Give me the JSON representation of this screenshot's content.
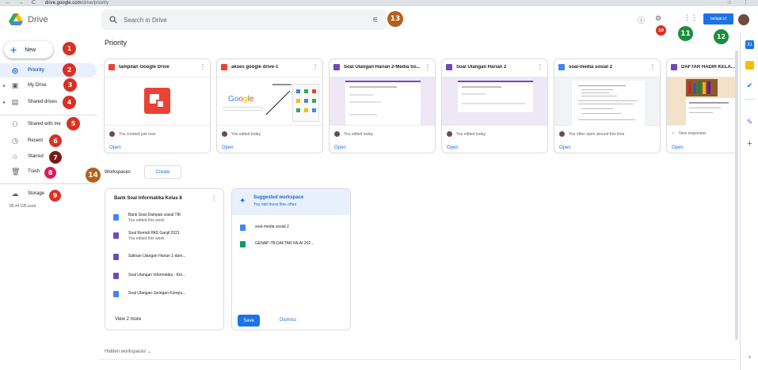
{
  "browser": {
    "nav": "← → C",
    "url_host": "drive.google.com",
    "url_path": "/drive/priority"
  },
  "app": {
    "name": "Drive",
    "search_placeholder": "Search in Drive"
  },
  "header": {
    "account_label": "belajar.id"
  },
  "sidebar": {
    "new_label": "New",
    "items": [
      {
        "label": "Priority",
        "icon": "checkmark-circle-icon"
      },
      {
        "label": "My Drive",
        "icon": "my-drive-icon"
      },
      {
        "label": "Shared drives",
        "icon": "shared-drives-icon"
      },
      {
        "label": "Shared with me",
        "icon": "people-icon"
      },
      {
        "label": "Recent",
        "icon": "clock-icon"
      },
      {
        "label": "Starred",
        "icon": "star-icon"
      },
      {
        "label": "Trash",
        "icon": "trash-icon"
      },
      {
        "label": "Storage",
        "icon": "cloud-icon"
      }
    ],
    "storage_used": "85.44 GB used"
  },
  "badges": [
    "1",
    "2",
    "3",
    "4",
    "5",
    "6",
    "7",
    "8",
    "9",
    "10",
    "11",
    "12",
    "13",
    "14"
  ],
  "colors": {
    "badge_red": "#d93025",
    "badge_dark_red": "#7b1a1a",
    "badge_brown": "#b45f1c",
    "badge_green": "#1e8e3e",
    "badge_magenta": "#d81b60",
    "accent": "#1a73e8"
  },
  "main": {
    "title": "Priority",
    "cards": [
      {
        "title": "tampilan Google Drive",
        "type": "slides",
        "meta": "You created just now",
        "action": "Open"
      },
      {
        "title": "akses google drive-1",
        "type": "slides",
        "meta": "You edited today",
        "action": "Open"
      },
      {
        "title": "Soal Ulangan Harian 2-Media So...",
        "type": "forms",
        "meta": "You edited today",
        "action": "Open"
      },
      {
        "title": "Soal Ulangan Harian 2",
        "type": "forms",
        "meta": "You edited today",
        "action": "Open"
      },
      {
        "title": "soal-media sosial 2",
        "type": "docs",
        "meta": "You often open around this time",
        "action": "Open"
      },
      {
        "title": "DAFTAR HADIR KELA...",
        "type": "forms",
        "meta": "New responses",
        "action": "Open"
      }
    ],
    "workspaces_label": "Workspaces",
    "create_label": "Create",
    "workspace": {
      "title": "Bank Soal Informatika Kelas 8",
      "items": [
        {
          "name": "Bank Soal-Dampak sosial TIK",
          "sub": "You edited this week",
          "type": "docs"
        },
        {
          "name": "Soal Remidi PAS Ganjil 2021",
          "sub": "You edited this week",
          "type": "forms"
        },
        {
          "name": "Salinan Ulangan Harian 1-dam...",
          "sub": "",
          "type": "forms"
        },
        {
          "name": "Soal Ulangan Informatika - Kel...",
          "sub": "",
          "type": "forms"
        },
        {
          "name": "Soal Ulangan-Jaringan Kompu...",
          "sub": "",
          "type": "docs"
        }
      ],
      "view_more": "View 2 more"
    },
    "suggested": {
      "title": "Suggested workspace",
      "subtitle": "You edit these files often",
      "items": [
        {
          "name": "soal-media sosial 2",
          "type": "docs"
        },
        {
          "name": "GENAP-7B-DAFTAR NILAI 202...",
          "type": "sheets"
        }
      ],
      "save_label": "Save",
      "dismiss_label": "Dismiss"
    },
    "hidden_workspaces": "Hidden workspaces"
  }
}
